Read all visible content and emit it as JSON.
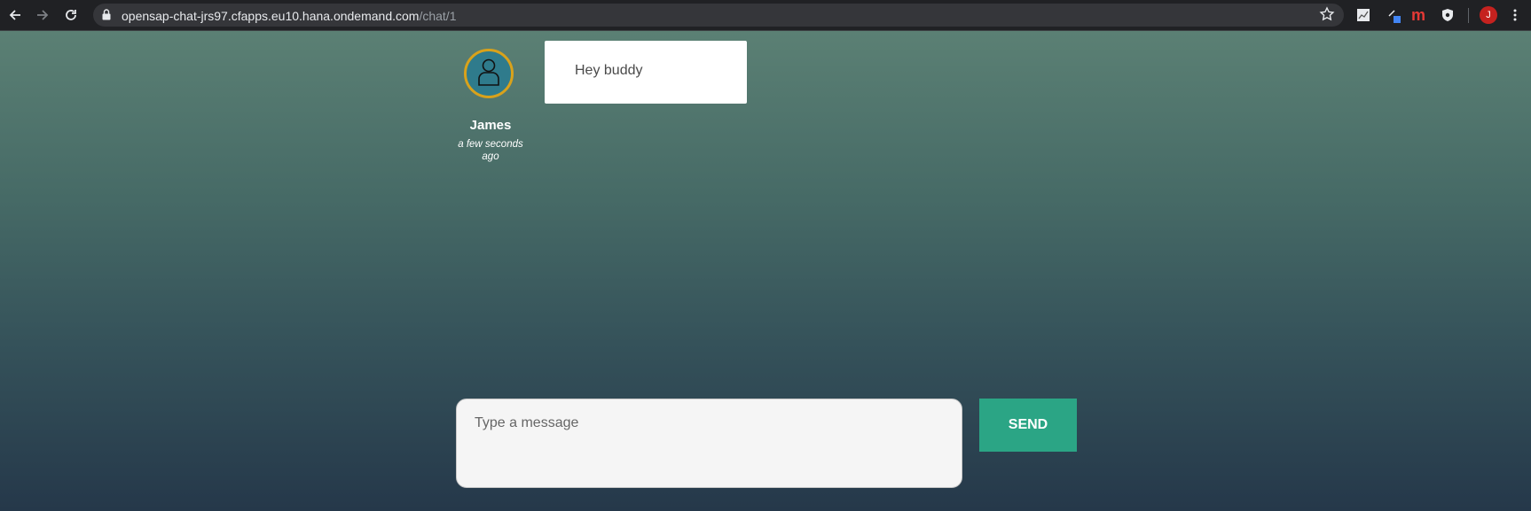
{
  "browser": {
    "url_host": "opensap-chat-jrs97.cfapps.eu10.hana.ondemand.com",
    "url_path": "/chat/1",
    "profile_initial": "J",
    "extensions": [
      "chart-extension-icon",
      "pen-extension-icon",
      "m-extension-icon",
      "shield-extension-icon"
    ]
  },
  "chat": {
    "messages": [
      {
        "author": "James",
        "time": "a few seconds ago",
        "text": "Hey buddy"
      }
    ]
  },
  "composer": {
    "placeholder": "Type a message",
    "value": "",
    "send_label": "SEND"
  },
  "colors": {
    "accent": "#2ba585",
    "avatar_ring": "#d9a21b",
    "avatar_fill": "#2f7b8c"
  }
}
